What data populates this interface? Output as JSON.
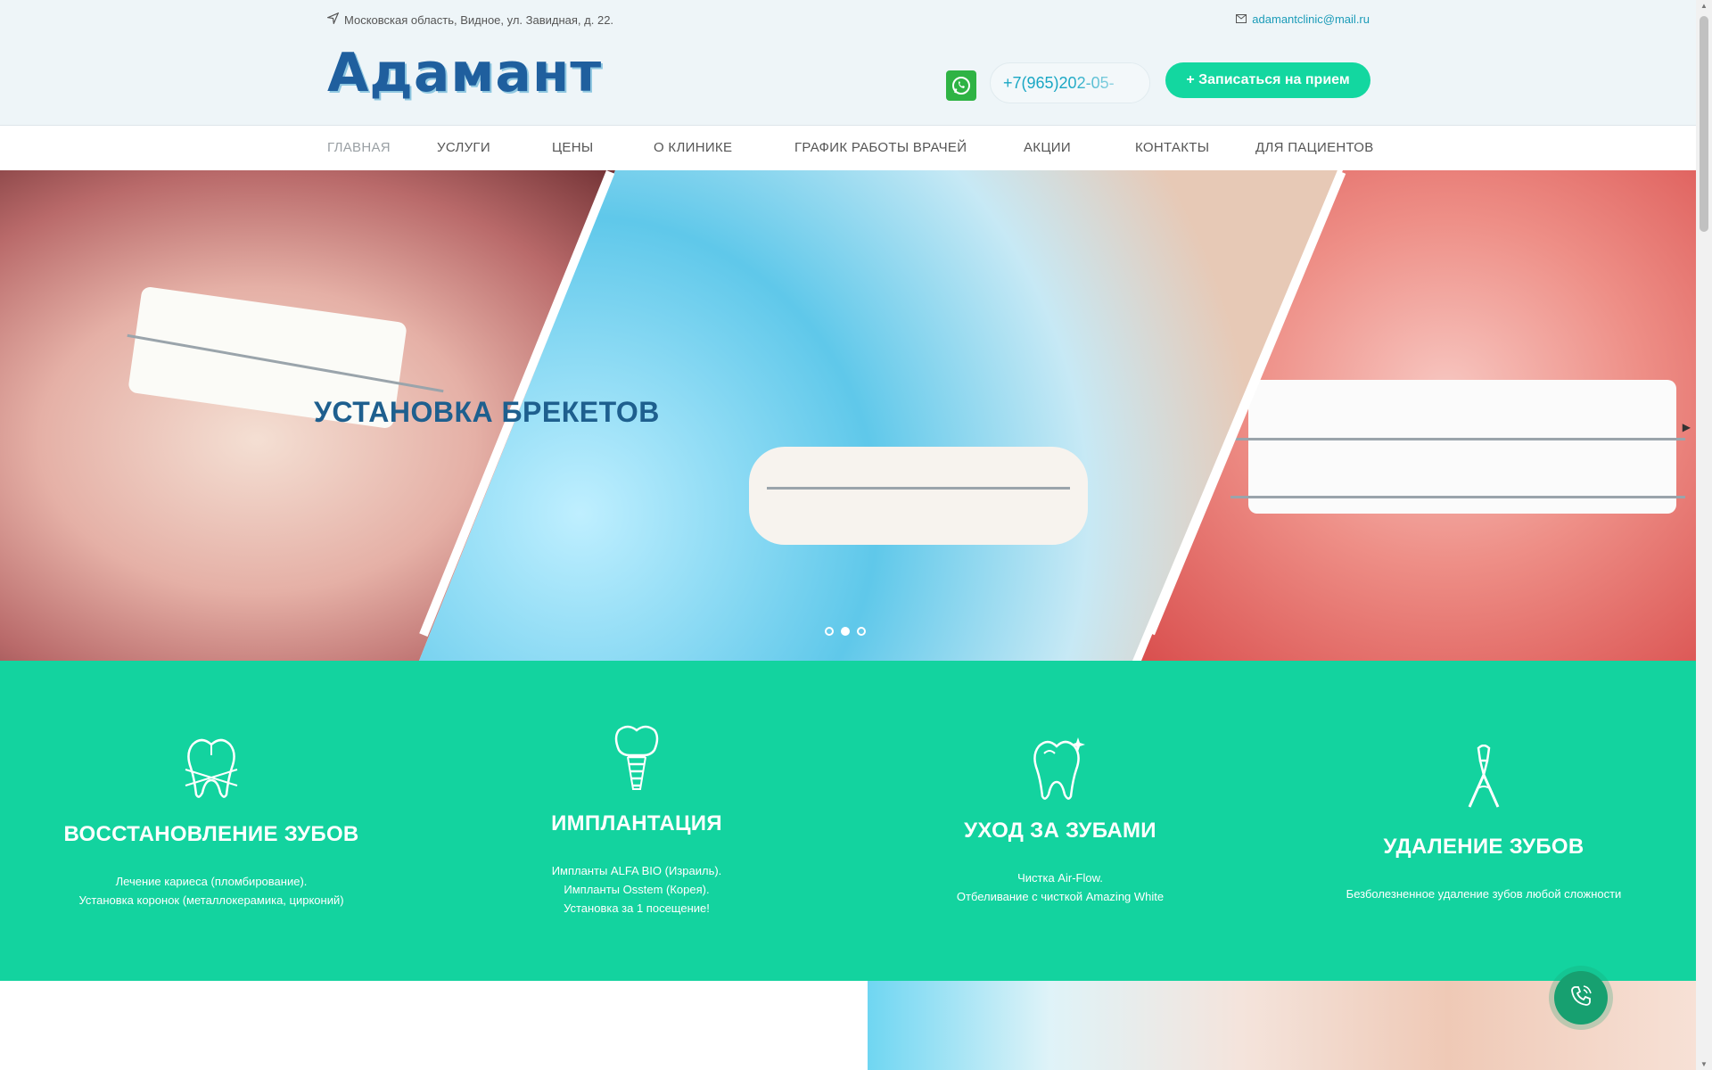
{
  "header": {
    "address": "Московская область, Видное, ул. Завидная, д. 22.",
    "email": "adamantclinic@mail.ru",
    "logo": "Адамант",
    "phone": "+7(965)202-05-",
    "book_button": "+ Записаться на прием"
  },
  "nav": {
    "items": [
      {
        "label": "ГЛАВНАЯ",
        "active": true
      },
      {
        "label": "УСЛУГИ"
      },
      {
        "label": "ЦЕНЫ"
      },
      {
        "label": "О КЛИНИКЕ"
      },
      {
        "label": "ГРАФИК РАБОТЫ ВРАЧЕЙ"
      },
      {
        "label": "АКЦИИ"
      },
      {
        "label": "КОНТАКТЫ"
      },
      {
        "label": "ДЛЯ ПАЦИЕНТОВ"
      }
    ]
  },
  "hero": {
    "title": "УСТАНОВКА БРЕКЕТОВ",
    "slides_total": 3,
    "active_slide": 2
  },
  "services": [
    {
      "icon": "tooth-restoration-icon",
      "title": "ВОССТАНОВЛЕНИЕ ЗУБОВ",
      "lines": [
        "Лечение кариеса (пломбирование).",
        "Установка коронок (металлокерамика, цирконий)"
      ]
    },
    {
      "icon": "dental-implant-icon",
      "title": "ИМПЛАНТАЦИЯ",
      "lines": [
        "Импланты ALFA BIO (Израиль).",
        "Импланты Osstem (Корея).",
        "Установка за 1 посещение!"
      ]
    },
    {
      "icon": "sparkling-tooth-icon",
      "title": "УХОД ЗА ЗУБАМИ",
      "lines": [
        "Чистка Air-Flow.",
        "Отбеливание с чисткой Amazing White"
      ]
    },
    {
      "icon": "dental-forceps-icon",
      "title": "УДАЛЕНИЕ ЗУБОВ",
      "lines": [
        "Безболезненное удаление зубов любой сложности"
      ]
    }
  ],
  "colors": {
    "accent": "#13d39f",
    "button": "#13d7a0",
    "logo": "#1f5f9e",
    "link": "#1a9bb8"
  }
}
